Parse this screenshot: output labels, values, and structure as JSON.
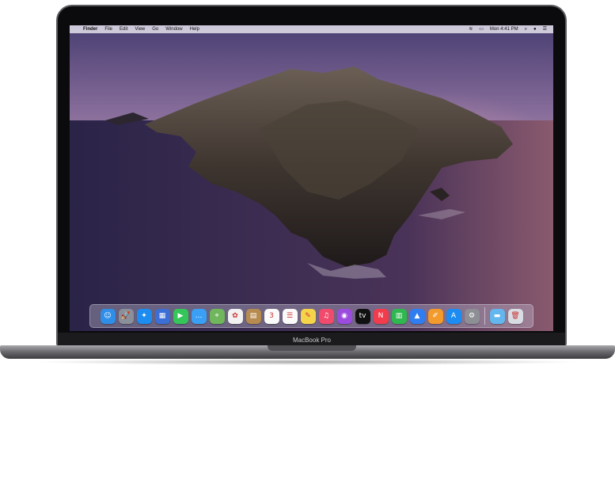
{
  "menubar": {
    "apple": "",
    "items": [
      "Finder",
      "File",
      "Edit",
      "View",
      "Go",
      "Window",
      "Help"
    ],
    "status": {
      "wifi_icon": "wifi-icon",
      "airplay_icon": "airplay-icon",
      "time": "Mon 4:41 PM",
      "search_icon": "search-icon",
      "siri_icon": "siri-icon",
      "control_icon": "notification-icon"
    }
  },
  "dock": {
    "apps": [
      {
        "name": "finder-icon",
        "glyph": "☺",
        "color": "#2f8ee8"
      },
      {
        "name": "launchpad-icon",
        "glyph": "🚀",
        "color": "#8a8f99"
      },
      {
        "name": "safari-icon",
        "glyph": "✦",
        "color": "#1d8cf0"
      },
      {
        "name": "photos-browser-icon",
        "glyph": "▦",
        "color": "#3b6fd6"
      },
      {
        "name": "facetime-icon",
        "glyph": "▶",
        "color": "#35c659"
      },
      {
        "name": "messages-icon",
        "glyph": "…",
        "color": "#3aa0f5"
      },
      {
        "name": "maps-icon",
        "glyph": "⌖",
        "color": "#6fb65c"
      },
      {
        "name": "photos-icon",
        "glyph": "✿",
        "color": "#f2f2f2"
      },
      {
        "name": "contacts-icon",
        "glyph": "▤",
        "color": "#b78b4f"
      },
      {
        "name": "calendar-icon",
        "glyph": "3",
        "color": "#fafafa"
      },
      {
        "name": "reminders-icon",
        "glyph": "☰",
        "color": "#fafafa"
      },
      {
        "name": "notes-icon",
        "glyph": "✎",
        "color": "#f6d44a"
      },
      {
        "name": "music-icon",
        "glyph": "♫",
        "color": "#f04b6d"
      },
      {
        "name": "podcasts-icon",
        "glyph": "◉",
        "color": "#9b4bde"
      },
      {
        "name": "tv-icon",
        "glyph": "tv",
        "color": "#111111"
      },
      {
        "name": "news-icon",
        "glyph": "N",
        "color": "#f23c4b"
      },
      {
        "name": "numbers-icon",
        "glyph": "▥",
        "color": "#2fb84f"
      },
      {
        "name": "keynote-icon",
        "glyph": "▲",
        "color": "#2f7df0"
      },
      {
        "name": "pages-icon",
        "glyph": "✐",
        "color": "#f29a2b"
      },
      {
        "name": "app-store-icon",
        "glyph": "A",
        "color": "#1c8cf2"
      },
      {
        "name": "system-preferences-icon",
        "glyph": "⚙",
        "color": "#8d8f95"
      }
    ],
    "extras": [
      {
        "name": "downloads-folder-icon",
        "glyph": "▬",
        "color": "#63b6ee"
      },
      {
        "name": "trash-icon",
        "glyph": "🗑",
        "color": "#d8dde3"
      }
    ]
  },
  "device": {
    "label": "MacBook Pro"
  }
}
